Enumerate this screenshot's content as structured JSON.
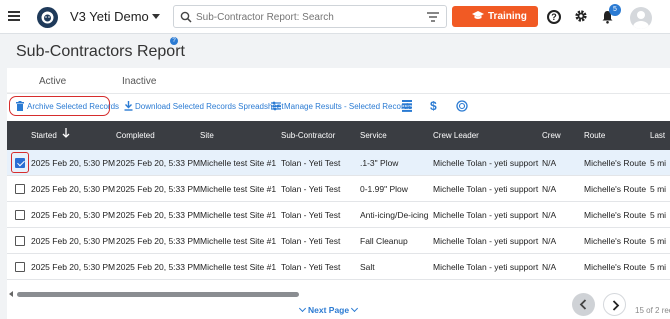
{
  "header": {
    "app_title": "V3 Yeti Demo",
    "search_placeholder": "Sub-Contractor Report: Search",
    "training_label": "Training",
    "help_label": "?",
    "notification_count": "5",
    "accent_color": "#f15a24"
  },
  "page": {
    "title": "Sub-Contractors Report",
    "title_help": "?"
  },
  "tabs": [
    {
      "label": "Active",
      "active": true
    },
    {
      "label": "Inactive",
      "active": false
    }
  ],
  "toolbar": {
    "archive_label": "Archive Selected Records",
    "download_label": "Download Selected Records Spreadsheet",
    "manage_label": "Manage Results - Selected Records"
  },
  "table": {
    "columns": [
      "Started",
      "Completed",
      "Site",
      "Sub-Contractor",
      "Service",
      "Crew Leader",
      "Crew",
      "Route",
      "Last"
    ],
    "rows": [
      {
        "checked": true,
        "started": "2025 Feb 20, 5:30 PM",
        "completed": "2025 Feb 20, 5:33 PM",
        "site": "Michelle test Site #1",
        "subcontractor": "Tolan - Yeti Test",
        "service": ".1-3\" Plow",
        "crew_leader": "Michelle Tolan - yeti support",
        "crew": "N/A",
        "route": "Michelle's Route",
        "last": "5 mi"
      },
      {
        "checked": false,
        "started": "2025 Feb 20, 5:30 PM",
        "completed": "2025 Feb 20, 5:33 PM",
        "site": "Michelle test Site #1",
        "subcontractor": "Tolan - Yeti Test",
        "service": "0-1.99\" Plow",
        "crew_leader": "Michelle Tolan - yeti support",
        "crew": "N/A",
        "route": "Michelle's Route",
        "last": "5 mi"
      },
      {
        "checked": false,
        "started": "2025 Feb 20, 5:30 PM",
        "completed": "2025 Feb 20, 5:33 PM",
        "site": "Michelle test Site #1",
        "subcontractor": "Tolan - Yeti Test",
        "service": "Anti-icing/De-icing",
        "crew_leader": "Michelle Tolan - yeti support",
        "crew": "N/A",
        "route": "Michelle's Route",
        "last": "5 mi"
      },
      {
        "checked": false,
        "started": "2025 Feb 20, 5:30 PM",
        "completed": "2025 Feb 20, 5:33 PM",
        "site": "Michelle test Site #1",
        "subcontractor": "Tolan - Yeti Test",
        "service": "Fall Cleanup",
        "crew_leader": "Michelle Tolan - yeti support",
        "crew": "N/A",
        "route": "Michelle's Route",
        "last": "5 mi"
      },
      {
        "checked": false,
        "started": "2025 Feb 20, 5:30 PM",
        "completed": "2025 Feb 20, 5:33 PM",
        "site": "Michelle test Site #1",
        "subcontractor": "Tolan - Yeti Test",
        "service": "Salt",
        "crew_leader": "Michelle Tolan - yeti support",
        "crew": "N/A",
        "route": "Michelle's Route",
        "last": "5 mi"
      }
    ]
  },
  "pagination": {
    "next_label": "Next Page",
    "count_text": "15 of 2 rec"
  }
}
